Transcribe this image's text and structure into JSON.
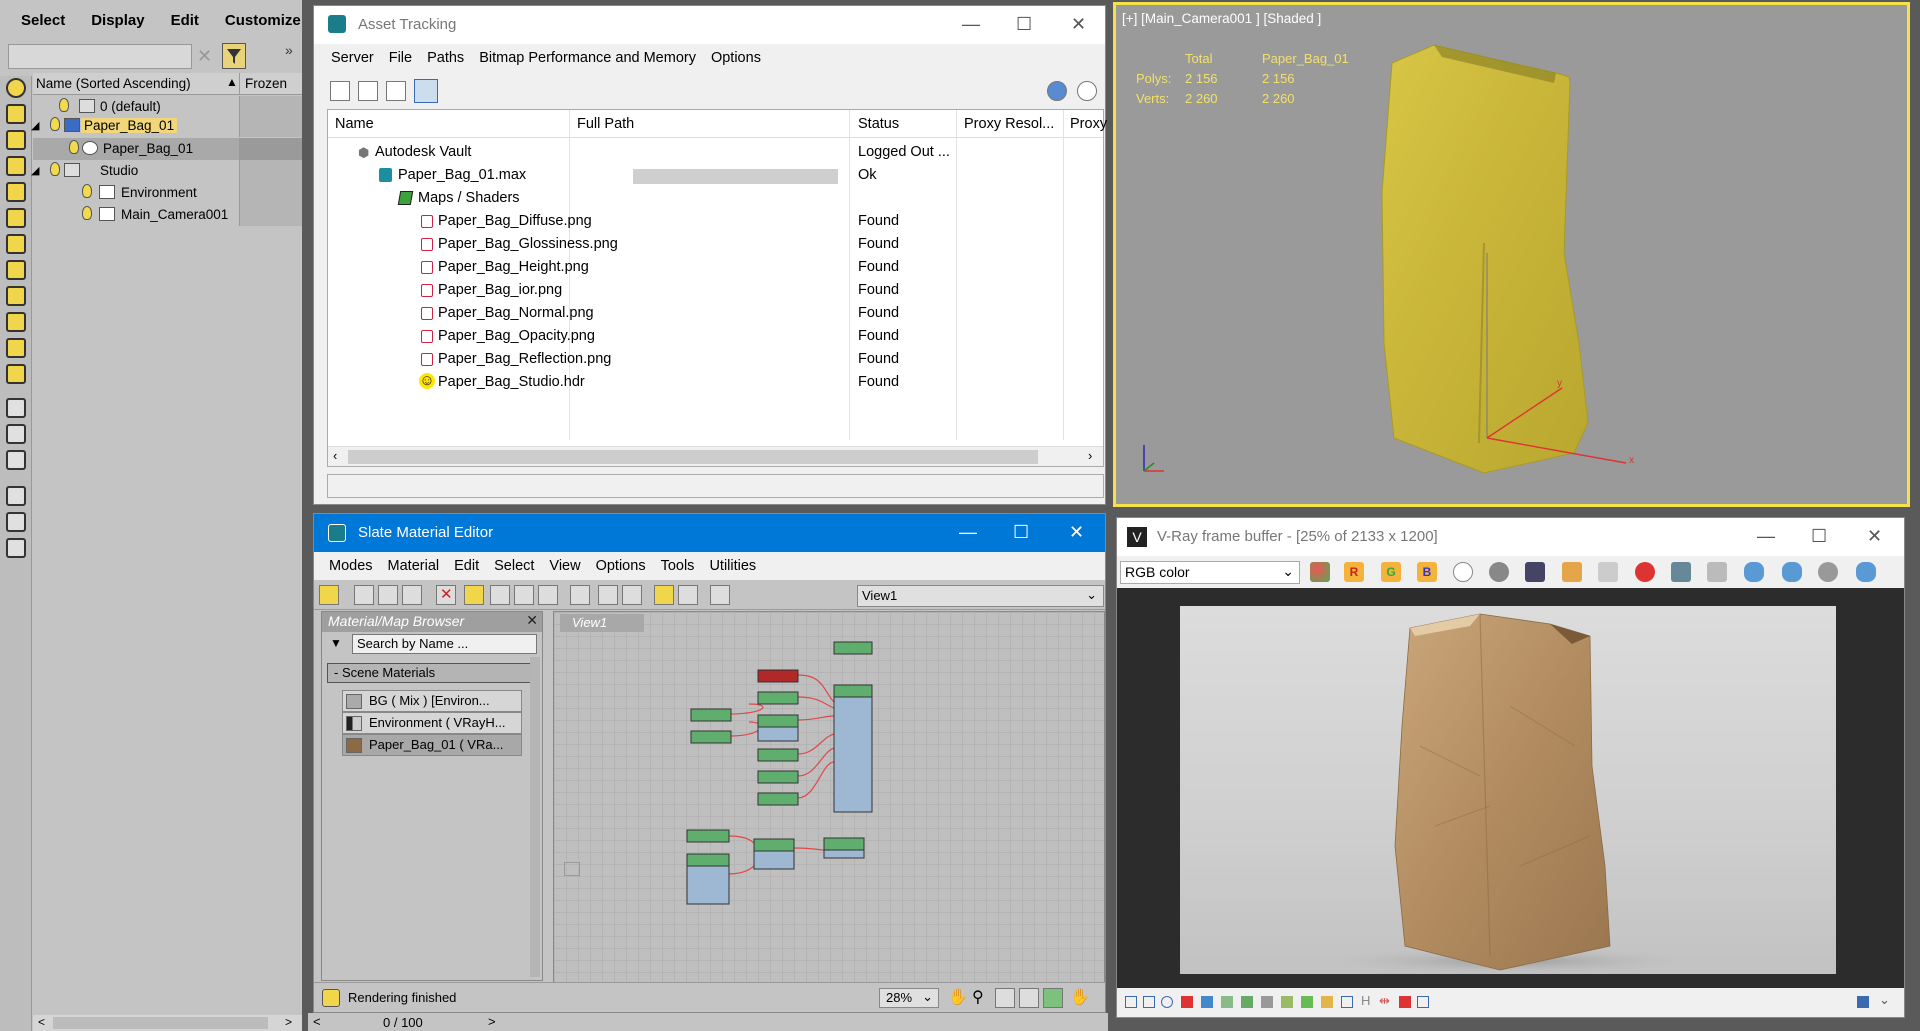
{
  "explorer": {
    "menu": [
      "Select",
      "Display",
      "Edit",
      "Customize"
    ],
    "header": {
      "name": "Name (Sorted Ascending)",
      "frozen": "Frozen"
    },
    "rows": [
      {
        "label": "0 (default)"
      },
      {
        "label": "Paper_Bag_01"
      },
      {
        "label": "Paper_Bag_01"
      },
      {
        "label": "Studio"
      },
      {
        "label": "Environment"
      },
      {
        "label": "Main_Camera001"
      }
    ]
  },
  "asset": {
    "title": "Asset Tracking",
    "menu": [
      "Server",
      "File",
      "Paths",
      "Bitmap Performance and Memory",
      "Options"
    ],
    "columns": [
      "Name",
      "Full Path",
      "Status",
      "Proxy Resol...",
      "Proxy"
    ],
    "rows": [
      {
        "name": "Autodesk Vault",
        "status": "Logged Out ..."
      },
      {
        "name": "Paper_Bag_01.max",
        "status": "Ok"
      },
      {
        "name": "Maps / Shaders",
        "status": ""
      },
      {
        "name": "Paper_Bag_Diffuse.png",
        "status": "Found"
      },
      {
        "name": "Paper_Bag_Glossiness.png",
        "status": "Found"
      },
      {
        "name": "Paper_Bag_Height.png",
        "status": "Found"
      },
      {
        "name": "Paper_Bag_ior.png",
        "status": "Found"
      },
      {
        "name": "Paper_Bag_Normal.png",
        "status": "Found"
      },
      {
        "name": "Paper_Bag_Opacity.png",
        "status": "Found"
      },
      {
        "name": "Paper_Bag_Reflection.png",
        "status": "Found"
      },
      {
        "name": "Paper_Bag_Studio.hdr",
        "status": "Found"
      }
    ]
  },
  "viewport": {
    "label": "[+] [Main_Camera001 ] [Shaded ]",
    "stats": {
      "total_label": "Total",
      "object_label": "Paper_Bag_01",
      "polys_label": "Polys:",
      "polys_total": "2 156",
      "polys_obj": "2 156",
      "verts_label": "Verts:",
      "verts_total": "2 260",
      "verts_obj": "2 260"
    },
    "accent": "#f5e14a"
  },
  "slate": {
    "title": "Slate Material Editor",
    "menu": [
      "Modes",
      "Material",
      "Edit",
      "Select",
      "View",
      "Options",
      "Tools",
      "Utilities"
    ],
    "view_select": "View1",
    "browser": {
      "title": "Material/Map Browser",
      "search_placeholder": "Search by Name ...",
      "section": "- Scene Materials",
      "materials": [
        "BG ( Mix ) [Environ...",
        "Environment ( VRayH...",
        "Paper_Bag_01 ( VRa..."
      ]
    },
    "tab": "View1",
    "status": "Rendering finished",
    "zoom": "28%",
    "frames": "0 / 100"
  },
  "vfb": {
    "title": "V-Ray frame buffer - [25% of 2133 x 1200]",
    "channel": "RGB color",
    "channel_buttons": [
      "R",
      "G",
      "B"
    ]
  }
}
